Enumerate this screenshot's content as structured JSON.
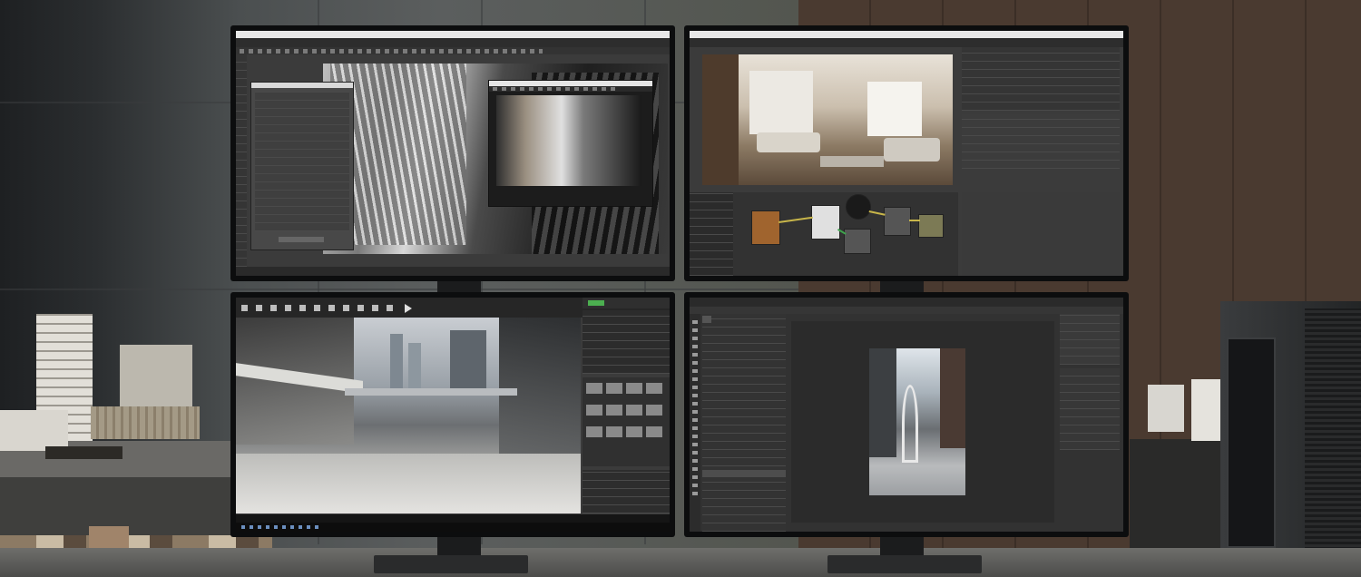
{
  "scene": {
    "description_visible_text": "",
    "colors": {
      "concrete": "#5b5e5e",
      "wood": "#4a3a30",
      "bezel": "#0c0d0e",
      "ui_dark": "#3b3b3b",
      "accent_green": "#4caf50"
    }
  },
  "monitors": [
    {
      "id": "top-left",
      "app": "3d-modeling",
      "window_title": "",
      "icons": [
        "window-icon",
        "toolbar-icons",
        "render-frame-icon"
      ]
    },
    {
      "id": "top-right",
      "app": "material-editor",
      "window_title": "",
      "icons": [
        "node-graph-icon",
        "scene-tree-icon"
      ]
    },
    {
      "id": "bottom-left",
      "app": "game-engine",
      "window_title": "",
      "icons": [
        "play-icon",
        "content-browser-icon"
      ]
    },
    {
      "id": "bottom-right",
      "app": "image-editor",
      "window_title": "",
      "icons": [
        "layers-icon",
        "toolbox-icon"
      ]
    }
  ]
}
